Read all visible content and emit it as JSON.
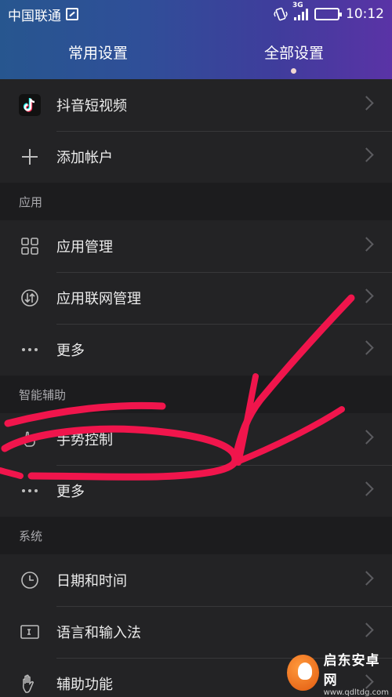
{
  "status_bar": {
    "carrier": "中国联通",
    "network": "3G",
    "time": "10:12"
  },
  "tabs": [
    {
      "label": "常用设置",
      "active": false
    },
    {
      "label": "全部设置",
      "active": true
    }
  ],
  "sections": {
    "accounts": [
      {
        "label": "抖音短视频",
        "icon": "tiktok-icon"
      },
      {
        "label": "添加帐户",
        "icon": "plus-icon"
      }
    ],
    "apps": {
      "title": "应用",
      "items": [
        {
          "label": "应用管理",
          "icon": "grid-icon"
        },
        {
          "label": "应用联网管理",
          "icon": "network-icon"
        },
        {
          "label": "更多",
          "icon": "more-icon"
        }
      ]
    },
    "assist": {
      "title": "智能辅助",
      "items": [
        {
          "label": "手势控制",
          "icon": "gesture-hand-icon"
        },
        {
          "label": "更多",
          "icon": "more-icon"
        }
      ]
    },
    "system": {
      "title": "系统",
      "items": [
        {
          "label": "日期和时间",
          "icon": "clock-icon"
        },
        {
          "label": "语言和输入法",
          "icon": "keyboard-icon"
        },
        {
          "label": "辅助功能",
          "icon": "hand-icon"
        }
      ]
    }
  },
  "watermark": {
    "title": "启东安卓网",
    "url": "www.qdltdg.com"
  },
  "colors": {
    "header_gradient_start": "#27568f",
    "header_gradient_end": "#5a33a6",
    "annotation": "#f0154c",
    "background": "#1c1c1e",
    "row": "#232325"
  }
}
